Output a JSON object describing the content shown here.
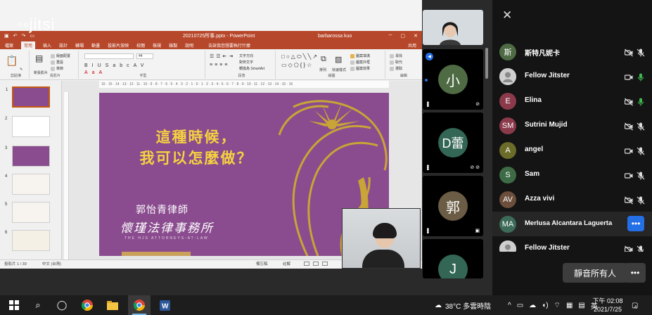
{
  "app": {
    "logo": "jitsi"
  },
  "ppt": {
    "filename": "20210725所事.pptx - PowerPoint",
    "user": "barbarossa kuo",
    "tabs": [
      "檔案",
      "常用",
      "插入",
      "設計",
      "轉場",
      "動畫",
      "投影片放映",
      "校閱",
      "檢視",
      "錄製",
      "說明",
      "告訴我您想要執行什麼"
    ],
    "active_tab": "常用",
    "share": "共用",
    "ribbon": {
      "groups": [
        "剪貼簿",
        "投影片",
        "字型",
        "段落",
        "繪圖",
        "編輯"
      ],
      "new_slide": "新投影片",
      "layout": "版面配置",
      "reset": "重設",
      "section": "章節",
      "text_direction": "文字方向",
      "align_text": "對齊文字",
      "smartart": "轉換為 SmartArt",
      "arrange": "排列",
      "quick_styles": "快速樣式",
      "shape_fill": "圖案填滿",
      "shape_outline": "圖案外框",
      "shape_effect": "圖案效果",
      "find": "尋找",
      "replace": "取代",
      "select": "選取",
      "font_size": "44",
      "format_painter": "複製格式"
    },
    "hruler": "16 · 15 · 14 · 13 · 12 · 11 · 10 · 9 · 8 · 7 · 6 · 5 · 4 · 3 · 2 · 1 · 0 · 1 · 2 · 3 · 4 · 5 · 6 · 7 · 8 · 9 · 10 · 11 · 12 · 13 · 14 · 15 · 16",
    "thumbs": [
      "1",
      "2",
      "3",
      "4",
      "5",
      "6"
    ],
    "status": {
      "slide": "投影片 1 / 39",
      "lang": "中文 (台灣)",
      "notes": "備忘稿",
      "comments": "註解"
    }
  },
  "slide": {
    "headline_1": "這種時候，",
    "headline_2": "我可以怎麼做？",
    "lawyer": "郭怡青律師",
    "firm": "懷瑾法律事務所",
    "firm_en": "THE HJS ATTORNEYS-AT-LAW"
  },
  "filmstrip": {
    "tiles": [
      {
        "initials": "小"
      },
      {
        "initials": "D蕾"
      },
      {
        "initials": "郭"
      },
      {
        "initials": "J"
      }
    ],
    "badge": "◀"
  },
  "panel": {
    "participants": [
      {
        "initials": "斯",
        "name": "斯特凡妮卡",
        "color": "#4e6b44",
        "cam": "off",
        "mic": "off"
      },
      {
        "initials": "",
        "name": "Fellow Jitster",
        "color": "#cfcfcf",
        "cam": "on",
        "mic": "on"
      },
      {
        "initials": "E",
        "name": "Elina",
        "color": "#8a3a4a",
        "cam": "off",
        "mic": "on"
      },
      {
        "initials": "SM",
        "name": "Sutrini Mujid",
        "color": "#8a3a4a",
        "cam": "off",
        "mic": "off"
      },
      {
        "initials": "A",
        "name": "angel",
        "color": "#6b6b2a",
        "cam": "on",
        "mic": "off"
      },
      {
        "initials": "S",
        "name": "Sam",
        "color": "#3d6b45",
        "cam": "on",
        "mic": "off"
      },
      {
        "initials": "AV",
        "name": "Azza vivi",
        "color": "#6b4e3b",
        "cam": "off",
        "mic": "off"
      },
      {
        "initials": "MA",
        "name": "Merlusa Alcantara Laguerta",
        "color": "#3d6b5a",
        "cam": "on",
        "mic": "off"
      },
      {
        "initials": "",
        "name": "Fellow Jitster",
        "color": "#cfcfcf",
        "cam": "off",
        "mic": "off"
      }
    ],
    "mute_all": "靜音所有人",
    "more": "•••"
  },
  "taskbar": {
    "weather": "38°C 多雲時陰",
    "ime": "英",
    "time": "下午 02:08",
    "date": "2021/7/25",
    "notifications": "4"
  },
  "colors": {
    "ppt_red": "#b7472a",
    "slide_purple": "#8a4c8f",
    "gold": "#f6d23f",
    "accent_blue": "#246fe5",
    "mic_green": "#3fb950"
  }
}
